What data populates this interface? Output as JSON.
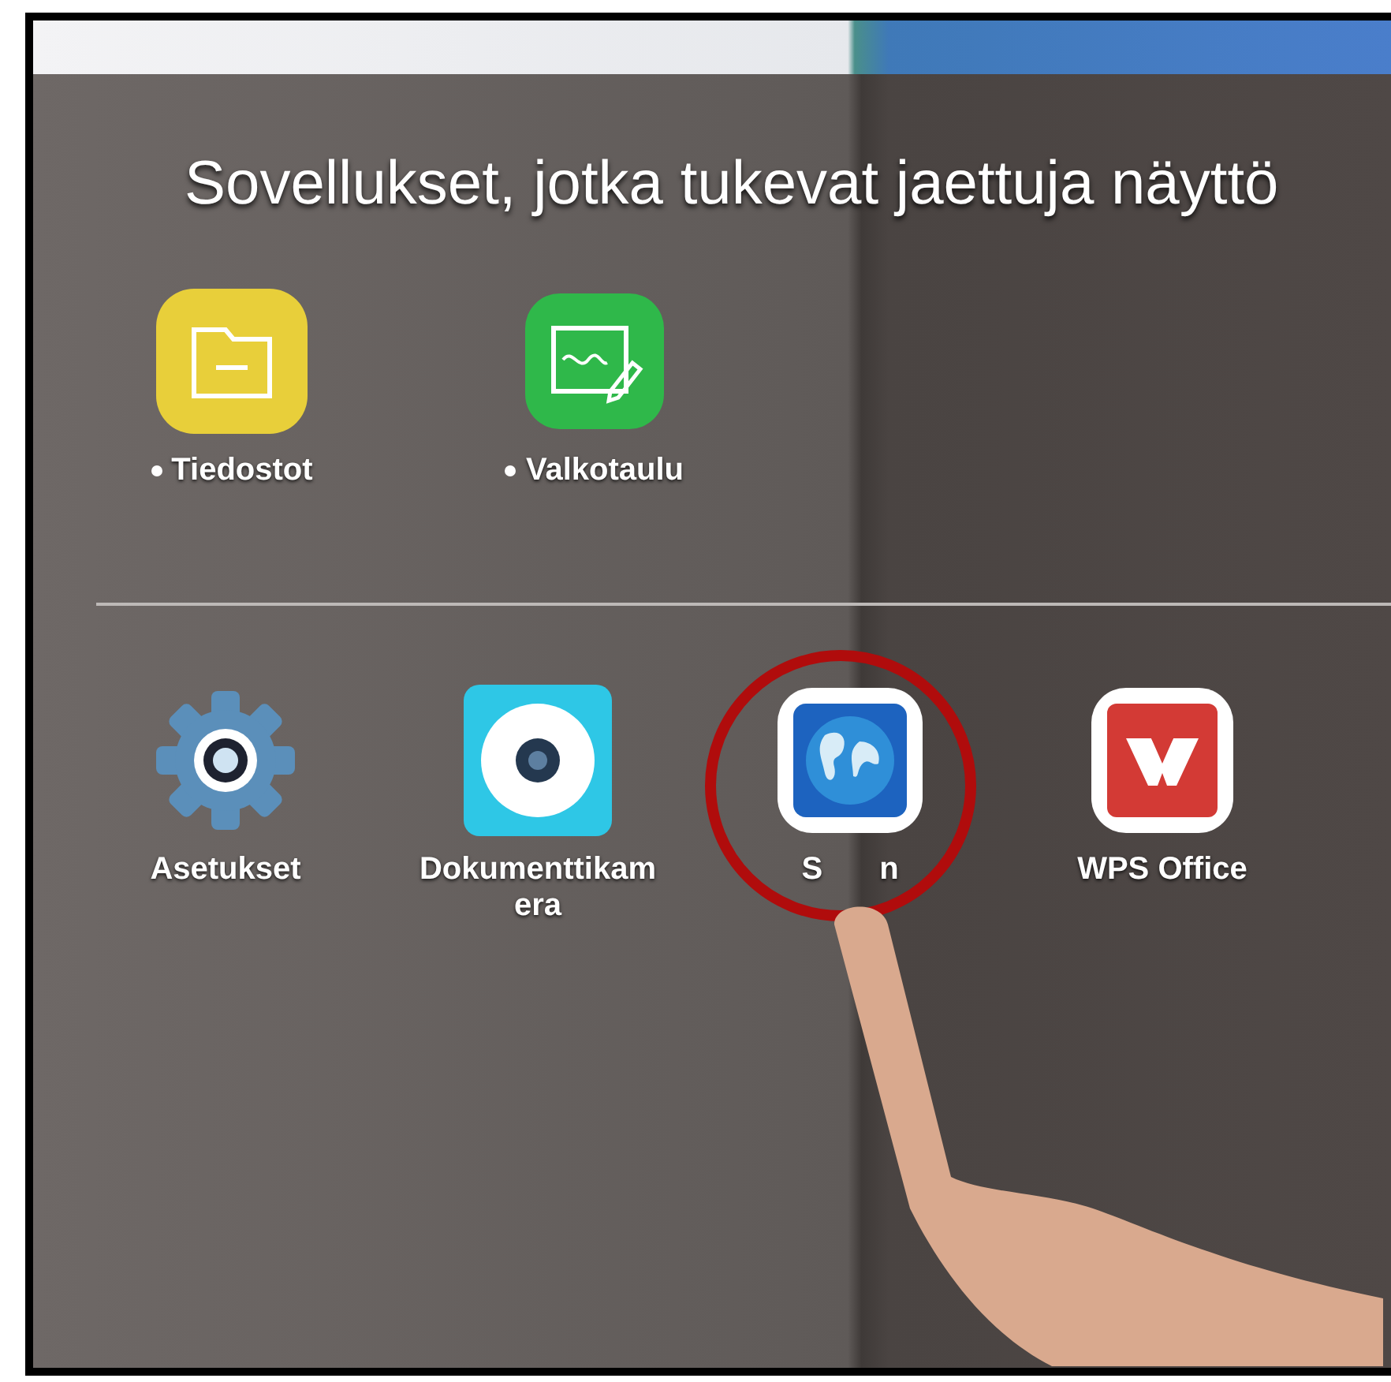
{
  "title": "Sovellukset, jotka tukevat jaettuja näyttö",
  "pinned_apps": [
    {
      "kind": "files",
      "label": "Tiedostot",
      "dot": true
    },
    {
      "kind": "whiteboard",
      "label": "Valkotaulu",
      "dot": true
    }
  ],
  "apps": [
    {
      "kind": "settings",
      "label_parts": [
        "Asetukset"
      ],
      "touched": false
    },
    {
      "kind": "camera",
      "label_parts": [
        "Dokumenttikam",
        "era"
      ],
      "touched": false
    },
    {
      "kind": "browser",
      "label_parts": [
        "S",
        "n"
      ],
      "touched": true
    },
    {
      "kind": "wps",
      "label_parts": [
        "WPS Office"
      ],
      "touched": false
    }
  ]
}
